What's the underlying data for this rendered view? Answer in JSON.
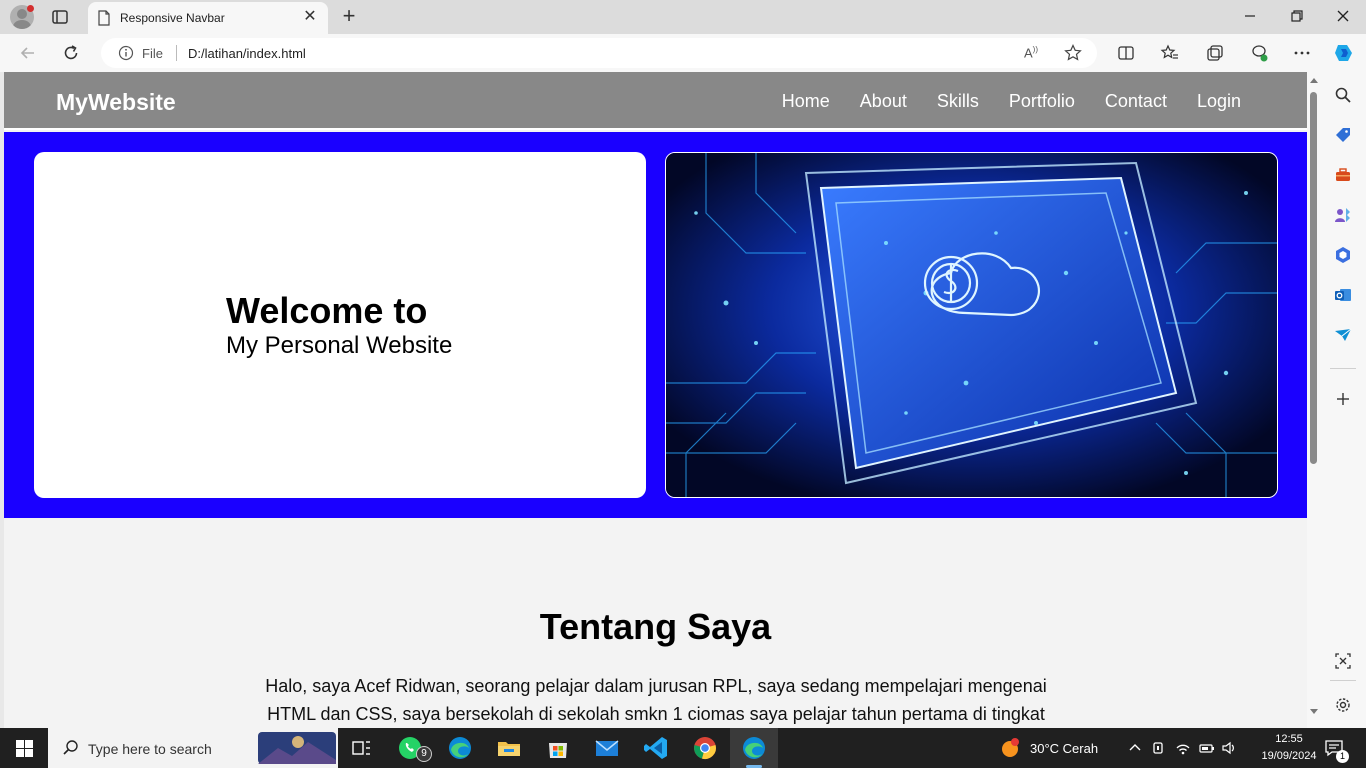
{
  "browser": {
    "tab_title": "Responsive Navbar",
    "url_scheme_label": "File",
    "url": "D:/latihan/index.html"
  },
  "page": {
    "brand": "MyWebsite",
    "nav_items": [
      "Home",
      "About",
      "Skills",
      "Portfolio",
      "Contact",
      "Login"
    ],
    "hero": {
      "title": "Welcome to",
      "subtitle": "My Personal Website"
    },
    "about": {
      "title": "Tentang Saya",
      "text": "Halo, saya Acef Ridwan, seorang pelajar dalam jurusan RPL, saya sedang mempelajari mengenai HTML dan CSS, saya bersekolah di sekolah smkn 1 ciomas saya pelajar tahun pertama di tingkat"
    },
    "colors": {
      "navbar": "#888888",
      "hero_background": "#1a00ff",
      "body_background": "#f3f3f3"
    }
  },
  "taskbar": {
    "search_placeholder": "Type here to search",
    "whatsapp_badge": "9",
    "weather": "30°C  Cerah",
    "time": "12:55",
    "date": "19/09/2024",
    "notification_count": "1",
    "apps": [
      "whatsapp-icon",
      "edge-icon",
      "file-explorer-icon",
      "microsoft-store-icon",
      "mail-icon",
      "vscode-icon",
      "chrome-icon",
      "edge-active-icon"
    ]
  }
}
